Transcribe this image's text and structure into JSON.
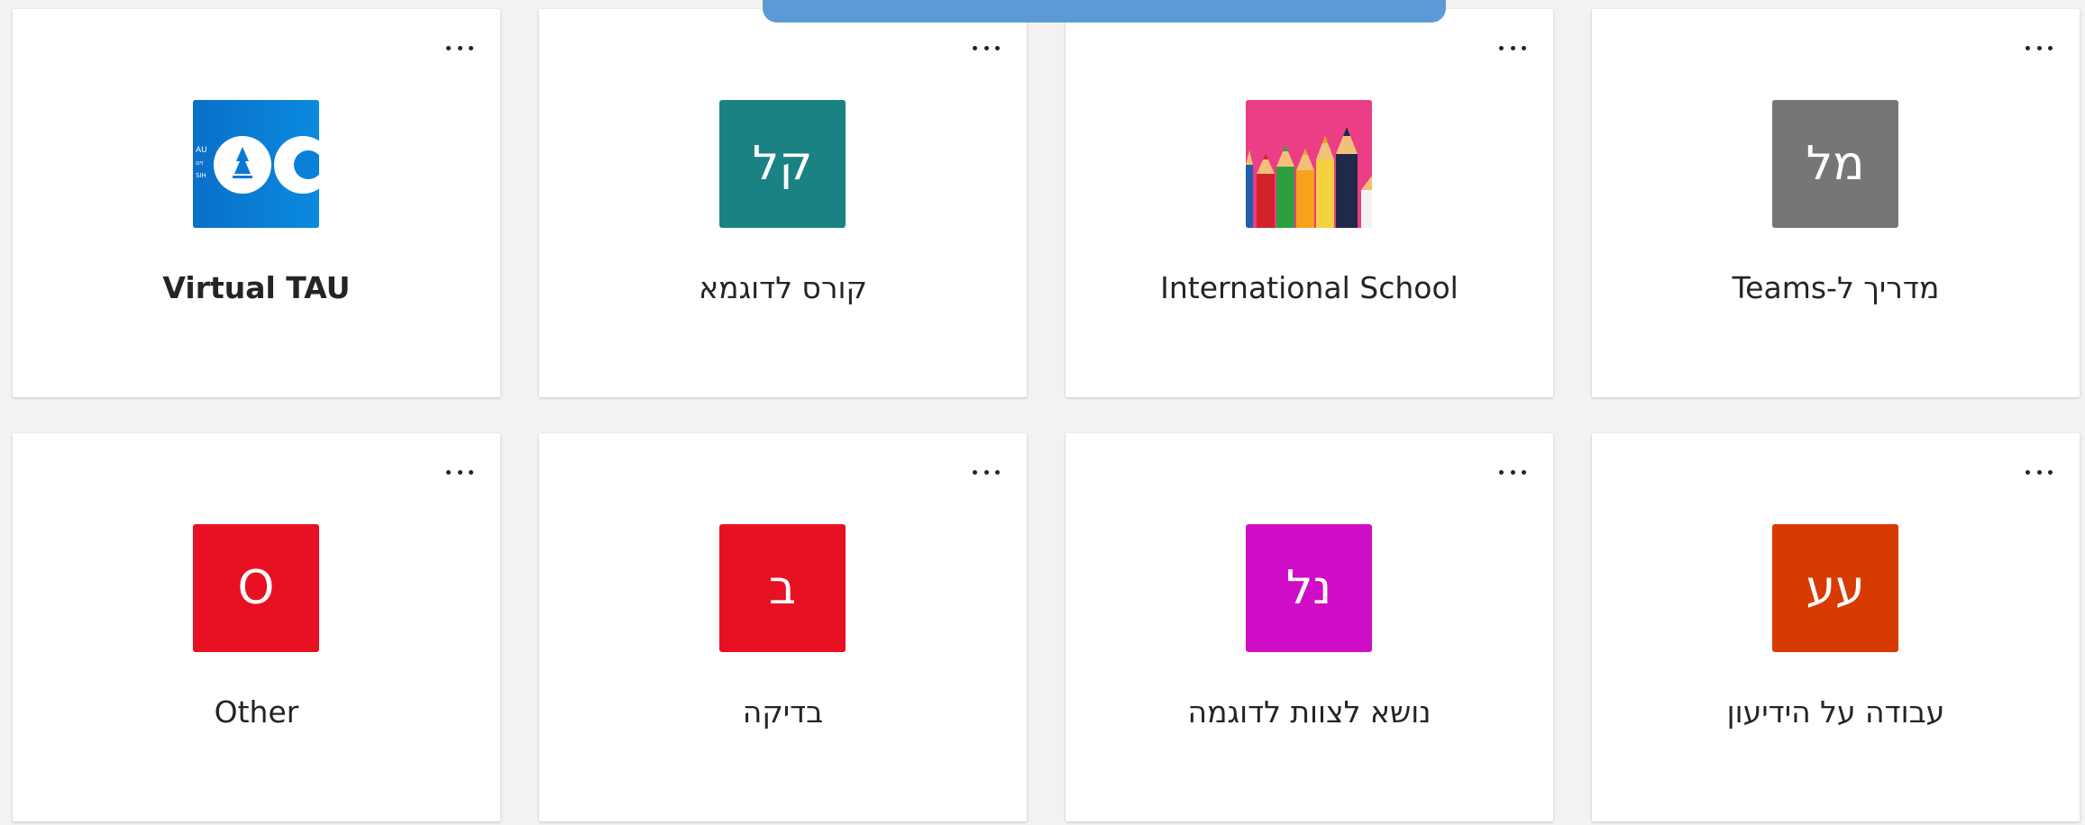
{
  "teams": [
    {
      "name": "Virtual TAU",
      "avatar_text": "",
      "avatar_color": "#0a78d4",
      "avatar_type": "tau-logo",
      "bold": true
    },
    {
      "name": "קורס לדוגמא",
      "avatar_text": "קל",
      "avatar_color": "#1b8283",
      "avatar_type": "initials",
      "bold": false
    },
    {
      "name": "International School",
      "avatar_text": "",
      "avatar_color": "#ec3d87",
      "avatar_type": "pencils",
      "bold": false
    },
    {
      "name": "מדריך ל-Teams",
      "avatar_text": "מל",
      "avatar_color": "#767676",
      "avatar_type": "initials",
      "bold": false
    },
    {
      "name": "Other",
      "avatar_text": "O",
      "avatar_color": "#e81123",
      "avatar_type": "initials",
      "bold": false
    },
    {
      "name": "בדיקה",
      "avatar_text": "ב",
      "avatar_color": "#e81123",
      "avatar_type": "initials",
      "bold": false
    },
    {
      "name": "נושא לצוות לדוגמה",
      "avatar_text": "נל",
      "avatar_color": "#d00dc6",
      "avatar_type": "initials",
      "bold": false
    },
    {
      "name": "עבודה על הידיעון",
      "avatar_text": "עע",
      "avatar_color": "#d83b01",
      "avatar_type": "initials",
      "bold": false
    }
  ],
  "overlay_bar_color": "#5b9bd5"
}
